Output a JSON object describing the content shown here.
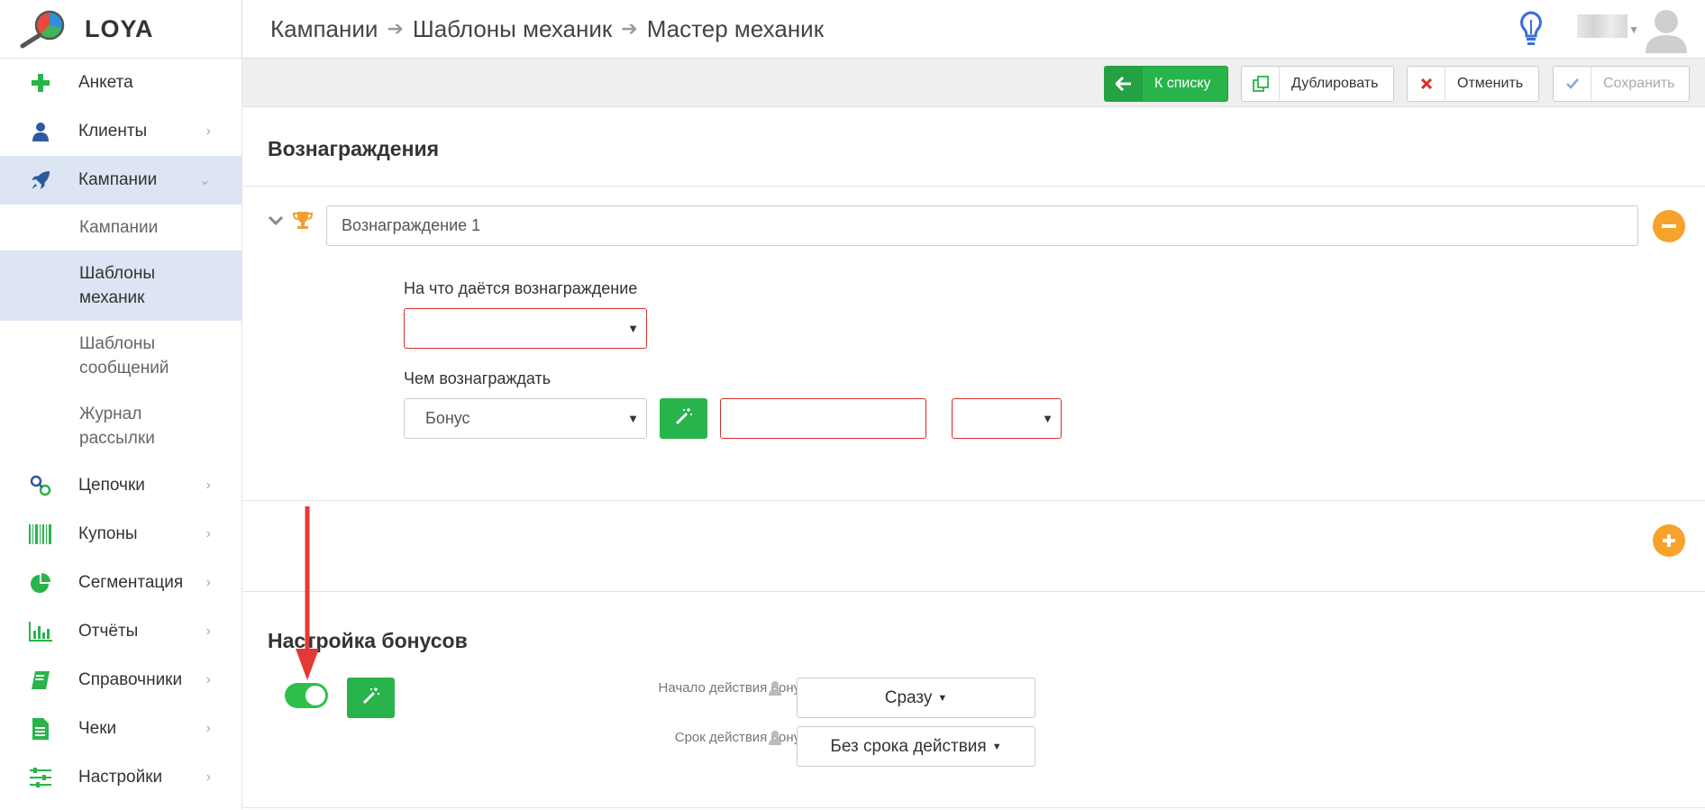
{
  "app": {
    "logo_text": "LOYA"
  },
  "sidebar": {
    "items": [
      {
        "label": "Анкета",
        "icon": "plus-icon",
        "chevron": false
      },
      {
        "label": "Клиенты",
        "icon": "user-icon",
        "chevron": true
      },
      {
        "label": "Кампании",
        "icon": "rocket-icon",
        "chevron": true,
        "expanded": true
      },
      {
        "label": "Цепочки",
        "icon": "link-icon",
        "chevron": true
      },
      {
        "label": "Купоны",
        "icon": "barcode-icon",
        "chevron": true
      },
      {
        "label": "Сегментация",
        "icon": "pie-chart-icon",
        "chevron": true
      },
      {
        "label": "Отчёты",
        "icon": "bar-chart-icon",
        "chevron": true
      },
      {
        "label": "Справочники",
        "icon": "book-icon",
        "chevron": true
      },
      {
        "label": "Чеки",
        "icon": "document-icon",
        "chevron": true
      },
      {
        "label": "Настройки",
        "icon": "sliders-icon",
        "chevron": true
      }
    ],
    "subitems": [
      {
        "label": "Кампании"
      },
      {
        "label": "Шаблоны механик",
        "active": true
      },
      {
        "label": "Шаблоны сообщений"
      },
      {
        "label": "Журнал рассылки"
      }
    ],
    "colors": {
      "icon_green": "#28b44b",
      "icon_blue": "#2c5aa0",
      "active_bg": "#dde4f3"
    }
  },
  "header": {
    "breadcrumbs": [
      "Кампании",
      "Шаблоны механик",
      "Мастер механик"
    ]
  },
  "toolbar": {
    "back_label": "К списку",
    "duplicate_label": "Дублировать",
    "cancel_label": "Отменить",
    "save_label": "Сохранить"
  },
  "rewards": {
    "section_title": "Вознаграждения",
    "item_name": "Вознаграждение 1",
    "target_label": "На что даётся вознаграждение",
    "target_value": "",
    "reward_with_label": "Чем вознаграждать",
    "reward_with_value": "Бонус",
    "amount_value": "",
    "unit_value": ""
  },
  "bonus_settings": {
    "section_title": "Настройка бонусов",
    "toggle_on": true,
    "start_label": "Начало действия бонусов",
    "start_value": "Сразу",
    "term_label": "Срок действия бонусов",
    "term_value": "Без срока действия"
  },
  "colors": {
    "accent_green": "#28b44b",
    "accent_orange": "#f6a22b",
    "error_red": "#d6302b",
    "annotation_red": "#e53935"
  }
}
